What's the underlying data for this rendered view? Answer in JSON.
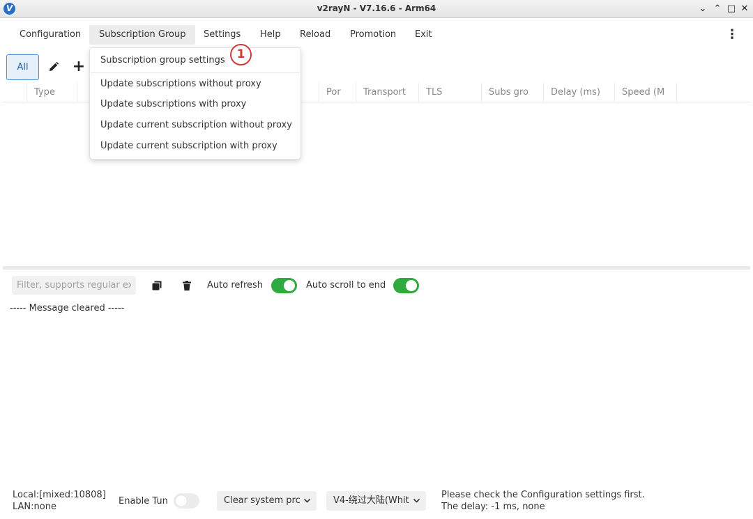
{
  "window": {
    "title": "v2rayN - V7.16.6 - Arm64",
    "logo_letter": "V",
    "minimize_glyph": "⌄",
    "restore_glyph": "⌃",
    "maximize_glyph": "□",
    "close_glyph": "✕"
  },
  "menu": {
    "items": [
      "Configuration",
      "Subscription Group",
      "Settings",
      "Help",
      "Reload",
      "Promotion",
      "Exit"
    ],
    "active": "Subscription Group"
  },
  "toolbar": {
    "group_all_label": "All",
    "edit_icon": "pencil-icon",
    "add_icon": "plus-icon"
  },
  "grid": {
    "columns": [
      "Type",
      "Por",
      "Transport",
      "TLS",
      "Subs gro",
      "Delay (ms)",
      "Speed (M"
    ]
  },
  "dropdown": {
    "items": [
      "Subscription group settings",
      "Update subscriptions without proxy",
      "Update subscriptions with proxy",
      "Update current subscription without proxy",
      "Update current subscription with proxy"
    ],
    "annotation": "1"
  },
  "log": {
    "filter_placeholder": "Filter, supports regular exp",
    "auto_refresh_label": "Auto refresh",
    "auto_refresh_on": true,
    "auto_scroll_label": "Auto scroll to end",
    "auto_scroll_on": true,
    "message": "----- Message cleared -----"
  },
  "status": {
    "local": "Local:[mixed:10808]",
    "lan": "LAN:none",
    "enable_tun_label": "Enable Tun",
    "enable_tun_on": false,
    "system_proxy_value": "Clear system prc",
    "routing_value": "V4-绕过大陆(Whit",
    "message_line1": "Please check the Configuration settings first.",
    "message_line2": "The delay: -1 ms, none"
  },
  "colors": {
    "toggle_on": "#2eaa3f",
    "accent": "#4a90d9",
    "annotation": "#d13a3a"
  }
}
